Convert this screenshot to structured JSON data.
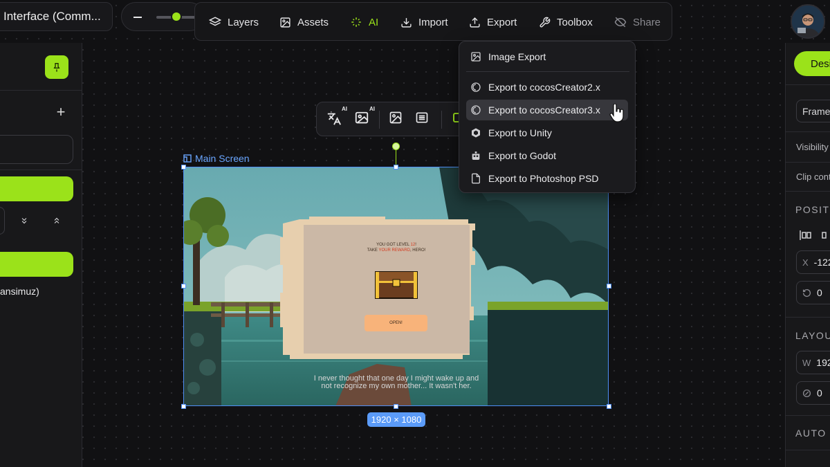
{
  "project": {
    "title": "Interface (Comm..."
  },
  "toolbar": {
    "items": [
      {
        "label": "Layers",
        "icon": "layers-icon"
      },
      {
        "label": "Assets",
        "icon": "image-icon"
      },
      {
        "label": "AI",
        "icon": "sparkle-icon"
      },
      {
        "label": "Import",
        "icon": "download-icon"
      },
      {
        "label": "Export",
        "icon": "upload-icon"
      },
      {
        "label": "Toolbox",
        "icon": "wrench-icon"
      },
      {
        "label": "Share",
        "icon": "share-off-icon"
      }
    ]
  },
  "zoom": {
    "level": 0.5
  },
  "export_menu": {
    "items": [
      {
        "label": "Image Export",
        "icon": "image-icon"
      },
      {
        "label": "Export to cocosCreator2.x",
        "icon": "cocos-icon"
      },
      {
        "label": "Export to cocosCreator3.x",
        "icon": "cocos-icon",
        "hovered": true
      },
      {
        "label": "Export to Unity",
        "icon": "unity-icon"
      },
      {
        "label": "Export to Godot",
        "icon": "godot-icon"
      },
      {
        "label": "Export to Photoshop PSD",
        "icon": "file-icon"
      }
    ]
  },
  "floating_toolbar": {
    "ai_badge_1": "AI",
    "ai_badge_2": "AI"
  },
  "frame": {
    "label": "Main Screen",
    "size": "1920 × 1080",
    "game": {
      "line1_prefix": "YOU GOT LEVEL ",
      "line1_value": "12",
      "line1_suffix": "!",
      "line2_prefix": "TAKE ",
      "line2_highlight": "YOUR REWARD",
      "line2_suffix": ", HERO!",
      "button": "OPEN!",
      "subtitle": "I never thought that one day I might wake up and not recognize my own mother... It wasn't her."
    }
  },
  "left_panel": {
    "list_item": "ansimuz)"
  },
  "right_panel": {
    "tab": "Desi",
    "frame_select": "Frame",
    "visibility": "Visibility",
    "clip": "Clip cont",
    "position_section": "POSITI",
    "x_label": "X",
    "x_value": "-122",
    "rotation_value": "0",
    "layout_section": "LAYOU",
    "w_label": "W",
    "w_value": "192",
    "radius_value": "0",
    "auto_layout_section": "AUTO L"
  },
  "colors": {
    "accent": "#9be21a",
    "selection": "#4f8ff7",
    "panel": "#18181a"
  }
}
